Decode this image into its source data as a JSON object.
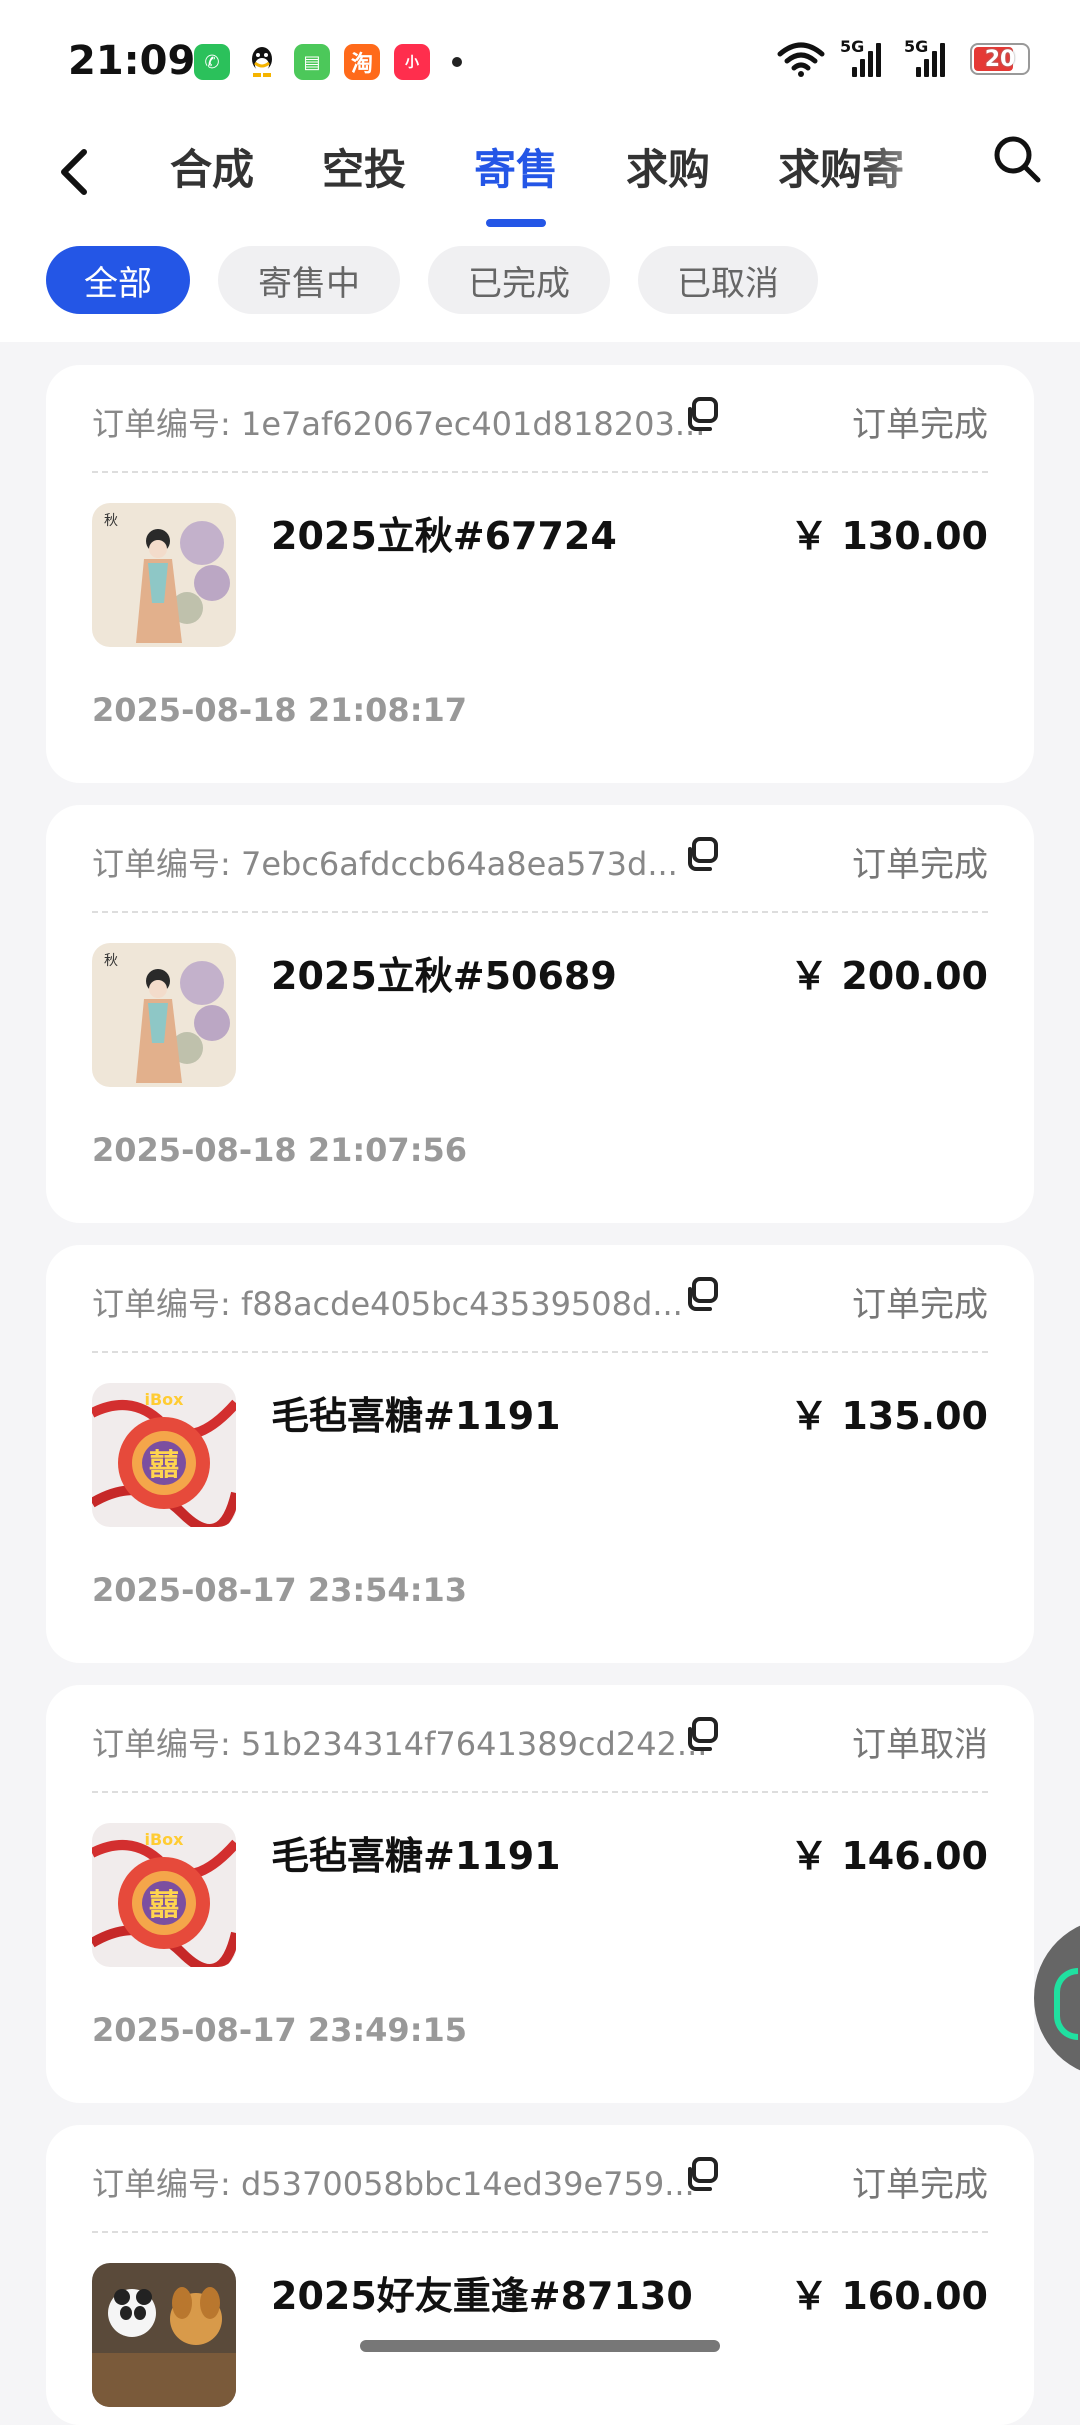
{
  "status_bar": {
    "time": "21:09",
    "app_icons": [
      {
        "name": "wechat-icon",
        "color": "#2bc15b",
        "glyph": "✆"
      },
      {
        "name": "qq-icon",
        "color": "#111111",
        "glyph": "◉"
      },
      {
        "name": "messages-icon",
        "color": "#4cc85a",
        "glyph": "▤"
      },
      {
        "name": "taobao-icon",
        "color": "#ff6a1a",
        "glyph": "淘"
      },
      {
        "name": "xiaohongshu-icon",
        "color": "#ff2e4d",
        "glyph": "小"
      }
    ],
    "network_1": "5G",
    "network_2": "5G",
    "battery_level": "20",
    "battery_color": "#e53935"
  },
  "nav": {
    "tabs": [
      "合成",
      "空投",
      "寄售",
      "求购",
      "求购寄"
    ],
    "active_tab_index": 2,
    "accent_color": "#2456e6"
  },
  "filters": {
    "chips": [
      "全部",
      "寄售中",
      "已完成",
      "已取消"
    ],
    "active_index": 0
  },
  "orders": [
    {
      "order_label": "订单编号: 1e7af62067ec401d818203...",
      "status": "订单完成",
      "name": "2025立秋#67724",
      "price": "￥ 130.00",
      "date": "2025-08-18 21:08:17",
      "thumb": "autumn-lady"
    },
    {
      "order_label": "订单编号: 7ebc6afdccb64a8ea573d...",
      "status": "订单完成",
      "name": "2025立秋#50689",
      "price": "￥ 200.00",
      "date": "2025-08-18 21:07:56",
      "thumb": "autumn-lady"
    },
    {
      "order_label": "订单编号: f88acde405bc43539508d...",
      "status": "订单完成",
      "name": "毛毡喜糖#1191",
      "price": "￥ 135.00",
      "date": "2025-08-17 23:54:13",
      "thumb": "felt-candy"
    },
    {
      "order_label": "订单编号: 51b234314f7641389cd242...",
      "status": "订单取消",
      "name": "毛毡喜糖#1191",
      "price": "￥ 146.00",
      "date": "2025-08-17 23:49:15",
      "thumb": "felt-candy"
    },
    {
      "order_label": "订单编号: d5370058bbc14ed39e759...",
      "status": "订单完成",
      "name": "2025好友重逢#87130",
      "price": "￥ 160.00",
      "date": "",
      "thumb": "friends-reunion"
    }
  ],
  "thumb_text": {
    "ibox": "iBox",
    "xi": "囍",
    "autumn": "秋"
  }
}
